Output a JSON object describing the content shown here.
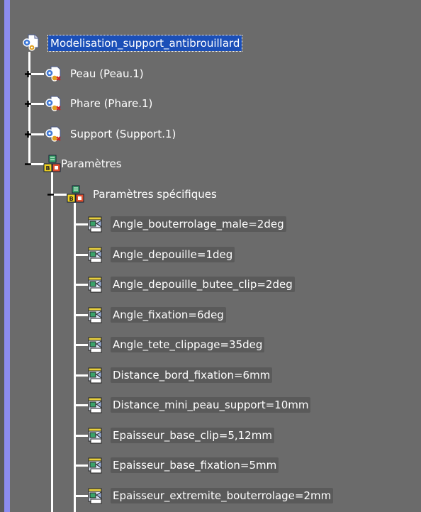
{
  "colors": {
    "background": "#6b6b6b",
    "spec_bar": "#8c8cf0",
    "selection": "#1b4fb8",
    "param_label_bg": "#5a5a5a",
    "tree_lines": "#ffffff"
  },
  "tree": {
    "root": {
      "label": "Modelisation_support_antibrouillard",
      "icon": "product-icon",
      "selected": true
    },
    "parts": [
      {
        "label": "Peau (Peau.1)",
        "icon": "part-instance-icon",
        "toggle": "expand"
      },
      {
        "label": "Phare (Phare.1)",
        "icon": "part-instance-icon",
        "toggle": "expand"
      },
      {
        "label": "Support (Support.1)",
        "icon": "part-instance-icon",
        "toggle": "expand"
      }
    ],
    "parameters": {
      "label": "Paramètres",
      "icon": "parameters-icon",
      "toggle": "collapse",
      "specific": {
        "label": "Paramètres spécifiques",
        "icon": "parameters-icon",
        "toggle": "collapse",
        "items": [
          "Angle_bouterrolage_male=2deg",
          "Angle_depouille=1deg",
          "Angle_depouille_butee_clip=2deg",
          "Angle_fixation=6deg",
          "Angle_tete_clippage=35deg",
          "Distance_bord_fixation=6mm",
          "Distance_mini_peau_support=10mm",
          "Epaisseur_base_clip=5,12mm",
          "Epaisseur_base_fixation=5mm",
          "Epaisseur_extremite_bouterrolage=2mm"
        ]
      }
    }
  }
}
